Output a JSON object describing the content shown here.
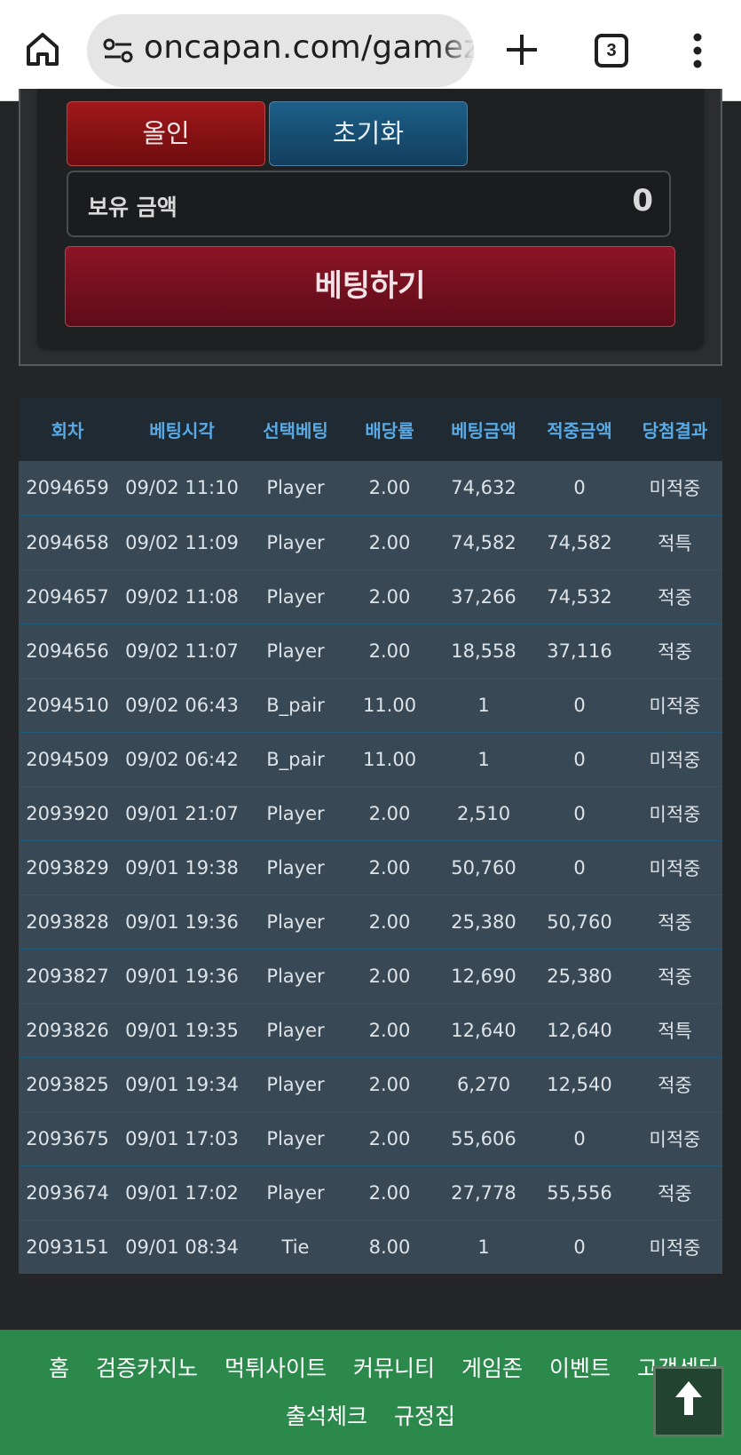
{
  "browser": {
    "url": "oncapan.com/gamezone",
    "tab_count": "3"
  },
  "bet_panel": {
    "allin_label": "올인",
    "reset_label": "초기화",
    "balance_label": "보유 금액",
    "balance_value": "0",
    "bet_button_label": "베팅하기"
  },
  "history": {
    "headers": [
      "회차",
      "베팅시각",
      "선택베팅",
      "배당률",
      "베팅금액",
      "적중금액",
      "당첨결과"
    ],
    "rows": [
      [
        "2094659",
        "09/02 11:10",
        "Player",
        "2.00",
        "74,632",
        "0",
        "미적중"
      ],
      [
        "2094658",
        "09/02 11:09",
        "Player",
        "2.00",
        "74,582",
        "74,582",
        "적특"
      ],
      [
        "2094657",
        "09/02 11:08",
        "Player",
        "2.00",
        "37,266",
        "74,532",
        "적중"
      ],
      [
        "2094656",
        "09/02 11:07",
        "Player",
        "2.00",
        "18,558",
        "37,116",
        "적중"
      ],
      [
        "2094510",
        "09/02 06:43",
        "B_pair",
        "11.00",
        "1",
        "0",
        "미적중"
      ],
      [
        "2094509",
        "09/02 06:42",
        "B_pair",
        "11.00",
        "1",
        "0",
        "미적중"
      ],
      [
        "2093920",
        "09/01 21:07",
        "Player",
        "2.00",
        "2,510",
        "0",
        "미적중"
      ],
      [
        "2093829",
        "09/01 19:38",
        "Player",
        "2.00",
        "50,760",
        "0",
        "미적중"
      ],
      [
        "2093828",
        "09/01 19:36",
        "Player",
        "2.00",
        "25,380",
        "50,760",
        "적중"
      ],
      [
        "2093827",
        "09/01 19:36",
        "Player",
        "2.00",
        "12,690",
        "25,380",
        "적중"
      ],
      [
        "2093826",
        "09/01 19:35",
        "Player",
        "2.00",
        "12,640",
        "12,640",
        "적특"
      ],
      [
        "2093825",
        "09/01 19:34",
        "Player",
        "2.00",
        "6,270",
        "12,540",
        "적중"
      ],
      [
        "2093675",
        "09/01 17:03",
        "Player",
        "2.00",
        "55,606",
        "0",
        "미적중"
      ],
      [
        "2093674",
        "09/01 17:02",
        "Player",
        "2.00",
        "27,778",
        "55,556",
        "적중"
      ],
      [
        "2093151",
        "09/01 08:34",
        "Tie",
        "8.00",
        "1",
        "0",
        "미적중"
      ]
    ]
  },
  "footer": {
    "nav_row1": [
      "홈",
      "검증카지노",
      "먹튀사이트",
      "커뮤니티",
      "게임존",
      "이벤트",
      "고객센터"
    ],
    "nav_row2": [
      "출석체크",
      "규정집"
    ]
  },
  "colors": {
    "header_text": "#58a9e4",
    "win": "#e9ae3d",
    "lose": "#e0373b",
    "footer_bg": "#2c894c"
  }
}
